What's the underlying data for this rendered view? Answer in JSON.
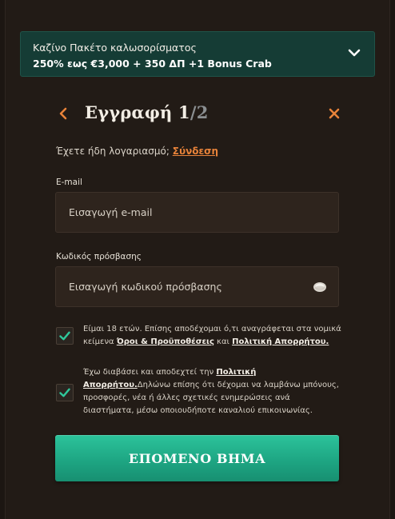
{
  "promo": {
    "line1": "Καζίνο Πακέτο καλωσορίσματος",
    "line2": "250% εως €3,000 + 350 ΔΠ +1 Bonus Crab"
  },
  "header": {
    "title_main": "Εγγραφή 1",
    "title_total": "/2"
  },
  "login": {
    "prompt": "Έχετε ήδη λογαριασμό;",
    "link": "Σύνδεση"
  },
  "email": {
    "label": "E-mail",
    "placeholder": "Εισαγωγή e-mail",
    "value": ""
  },
  "password": {
    "label": "Κωδικός πρόσβασης",
    "placeholder": "Εισαγωγή κωδικού πρόσβασης",
    "value": ""
  },
  "consent1": {
    "checked": true,
    "text_before": "Είμαι 18 ετών. Επίσης αποδέχομαι ό,τι αναγράφεται στα νομικά κείμενα ",
    "link_terms": "Όροι & Προϋποθέσεις",
    "text_and": " και ",
    "link_privacy": "Πολιτική Απορρήτου."
  },
  "consent2": {
    "checked": true,
    "text_before": "Έχω διαβάσει και αποδεχτεί την ",
    "link_privacy": "Πολιτική Απορρήτου.",
    "text_after": "Δηλώνω επίσης ότι δέχομαι να λαμβάνω μπόνους, προσφορές, νέα ή άλλες σχετικές ενημερώσεις ανά διαστήματα, μέσω οποιουδήποτε καναλιού επικοινωνίας."
  },
  "cta": {
    "label": "ΕΠΟΜΕΝΟ ΒΗΜΑ"
  },
  "colors": {
    "accent_orange": "#e8833a",
    "check_green": "#2fc79b",
    "cta_green": "#1ea683",
    "promo_bg": "#153c35",
    "panel_bg": "#221b16"
  },
  "icons": {
    "promo": "chevron-down-icon",
    "back": "chevron-left-icon",
    "close": "close-icon",
    "password": "eye-icon",
    "checkbox": "checkmark-icon"
  }
}
